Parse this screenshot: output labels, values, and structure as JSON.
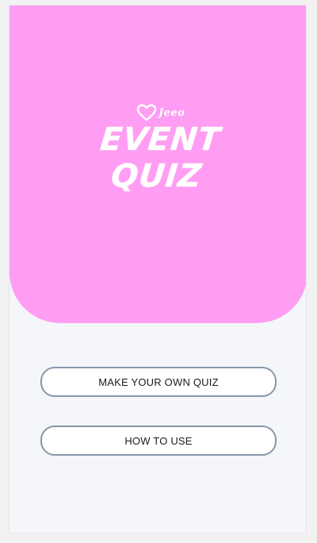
{
  "hero": {
    "brand": "Jeeo",
    "title": "EVENT QUIZ",
    "background_color": "#ff9df3"
  },
  "actions": {
    "make_quiz_label": "MAKE YOUR OWN QUIZ",
    "how_to_use_label": "HOW TO USE"
  },
  "colors": {
    "button_border": "#8796ab",
    "page_background": "#f4f6f9"
  },
  "icons": {
    "logo_mark": "heart-icon"
  }
}
